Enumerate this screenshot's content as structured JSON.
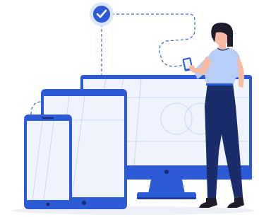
{
  "illustration": {
    "devices": [
      "phone",
      "tablet",
      "desktop-monitor",
      "handheld-phone"
    ],
    "icons": [
      "check-icon"
    ],
    "figure": "woman-holding-phone",
    "colors": {
      "primary": "#2d5bd6",
      "primary_dark": "#1f3f9e",
      "screen": "#eef3fd",
      "screen_lines": "#c9d6f7",
      "navy": "#1b2c6b",
      "shirt": "#b7cdf5",
      "hair": "#1d1d2b",
      "skin": "#f6b9a3",
      "dash": "#3b66d9",
      "shadow": "#eceff6"
    }
  }
}
